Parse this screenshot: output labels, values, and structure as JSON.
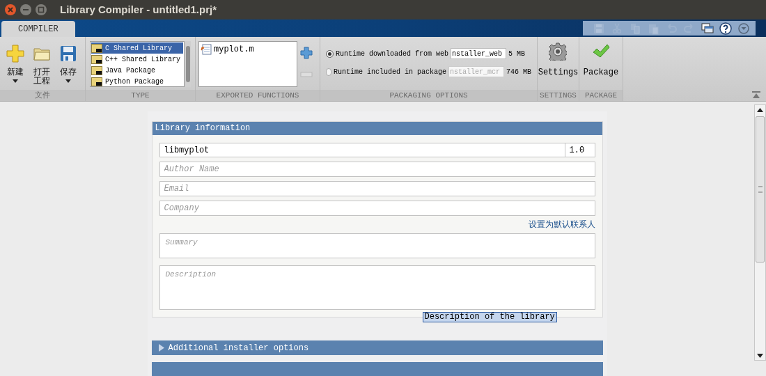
{
  "window": {
    "title": "Library Compiler - untitled1.prj*"
  },
  "tabs": [
    {
      "label": "COMPILER",
      "selected": true
    }
  ],
  "quick_access": [
    {
      "kind": "save",
      "disabled": true
    },
    {
      "kind": "cut",
      "disabled": true
    },
    {
      "kind": "copy",
      "disabled": true
    },
    {
      "kind": "paste",
      "disabled": true
    },
    {
      "kind": "undo",
      "disabled": true
    },
    {
      "kind": "redo",
      "disabled": true
    },
    {
      "kind": "layout",
      "disabled": false
    },
    {
      "kind": "help",
      "disabled": false
    },
    {
      "kind": "more",
      "disabled": false
    }
  ],
  "toolstrip": {
    "file": {
      "label": "文件",
      "buttons": [
        {
          "kind": "new",
          "label": "新建",
          "menu": true
        },
        {
          "kind": "open",
          "label": "打开工程",
          "menu": false
        },
        {
          "kind": "save",
          "label": "保存",
          "menu": true
        }
      ]
    },
    "type": {
      "label": "TYPE",
      "items": [
        {
          "label": "C Shared Library",
          "selected": true
        },
        {
          "label": "C++ Shared Library",
          "selected": false
        },
        {
          "label": "Java Package",
          "selected": false
        },
        {
          "label": "Python Package",
          "selected": false
        }
      ]
    },
    "exported": {
      "label": "EXPORTED FUNCTIONS",
      "files": [
        "myplot.m"
      ]
    },
    "packaging": {
      "label": "PACKAGING OPTIONS",
      "options": [
        {
          "label": "Runtime downloaded from web",
          "selected": true,
          "file": "nstaller_web",
          "size": "5 MB",
          "disabled": false
        },
        {
          "label": "Runtime included in package",
          "selected": false,
          "file": "nstaller_mcr",
          "size": "746 MB",
          "disabled": true
        }
      ]
    },
    "settings": {
      "label": "SETTINGS",
      "button": "Settings"
    },
    "package": {
      "label": "PACKAGE",
      "button": "Package"
    }
  },
  "library_information": {
    "title": "Library information",
    "name": "libmyplot",
    "version": "1.0",
    "author": {
      "placeholder": "Author Name"
    },
    "email": {
      "placeholder": "Email"
    },
    "company": {
      "placeholder": "Company"
    },
    "default_contact_link": "设置为默认联系人",
    "summary": {
      "placeholder": "Summary"
    },
    "description": {
      "placeholder": "Description"
    },
    "tooltip": "Description of the library"
  },
  "sections": [
    {
      "title": "Additional installer options",
      "expanded": false
    }
  ]
}
